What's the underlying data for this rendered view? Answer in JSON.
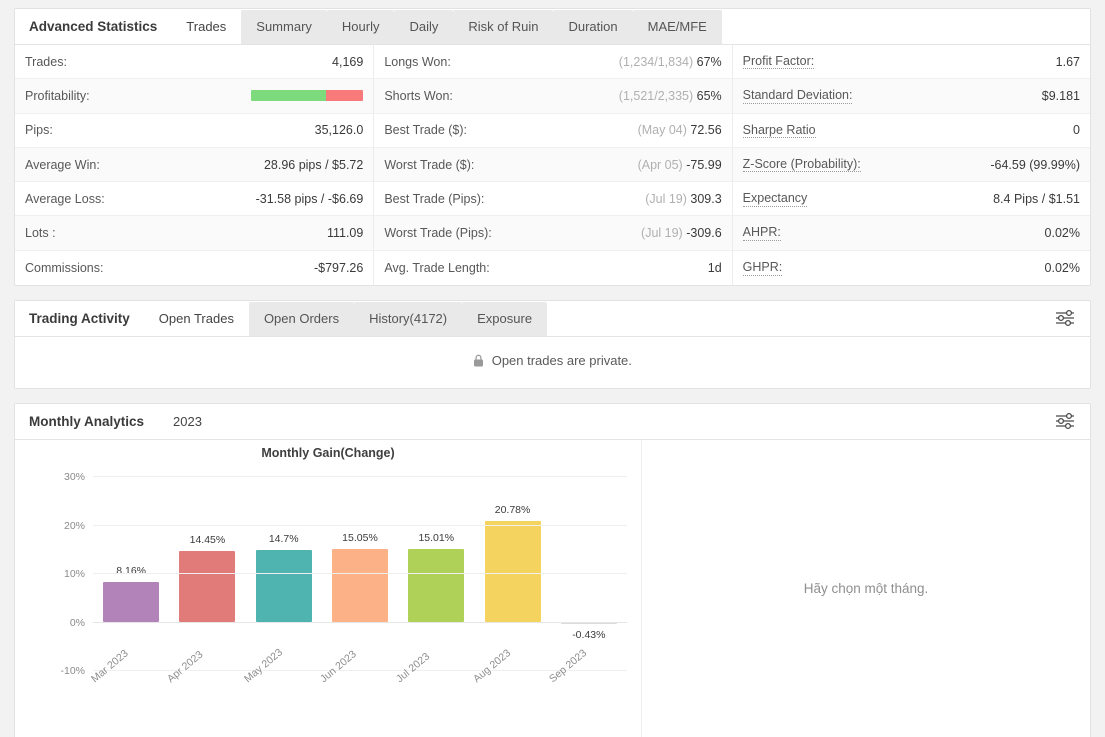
{
  "advanced_statistics": {
    "title": "Advanced Statistics",
    "tabs": [
      {
        "label": "Trades",
        "active": true
      },
      {
        "label": "Summary",
        "active": false
      },
      {
        "label": "Hourly",
        "active": false
      },
      {
        "label": "Daily",
        "active": false
      },
      {
        "label": "Risk of Ruin",
        "active": false
      },
      {
        "label": "Duration",
        "active": false
      },
      {
        "label": "MAE/MFE",
        "active": false
      }
    ],
    "columns": [
      {
        "rows": [
          {
            "label": "Trades:",
            "value": "4,169",
            "tip": false
          },
          {
            "label": "Profitability:",
            "value": "",
            "tip": false,
            "bar": {
              "win_pct": 67,
              "loss_pct": 33,
              "win_color": "#7ddb7d",
              "loss_color": "#f97a7a"
            }
          },
          {
            "label": "Pips:",
            "value": "35,126.0",
            "tip": false
          },
          {
            "label": "Average Win:",
            "value": "28.96 pips / $5.72",
            "tip": false
          },
          {
            "label": "Average Loss:",
            "value": "-31.58 pips / -$6.69",
            "tip": false
          },
          {
            "label": "Lots :",
            "value": "111.09",
            "tip": false
          },
          {
            "label": "Commissions:",
            "value": "-$797.26",
            "tip": false
          }
        ]
      },
      {
        "rows": [
          {
            "label": "Longs Won:",
            "muted": "(1,234/1,834)",
            "value": "67%",
            "tip": false
          },
          {
            "label": "Shorts Won:",
            "muted": "(1,521/2,335)",
            "value": "65%",
            "tip": false
          },
          {
            "label": "Best Trade ($):",
            "muted": "(May 04)",
            "value": "72.56",
            "tip": false
          },
          {
            "label": "Worst Trade ($):",
            "muted": "(Apr 05)",
            "value": "-75.99",
            "tip": false
          },
          {
            "label": "Best Trade (Pips):",
            "muted": "(Jul 19)",
            "value": "309.3",
            "tip": false
          },
          {
            "label": "Worst Trade (Pips):",
            "muted": "(Jul 19)",
            "value": "-309.6",
            "tip": false
          },
          {
            "label": "Avg. Trade Length:",
            "muted": "",
            "value": "1d",
            "tip": false
          }
        ]
      },
      {
        "rows": [
          {
            "label": "Profit Factor:",
            "value": "1.67",
            "tip": true
          },
          {
            "label": "Standard Deviation:",
            "value": "$9.181",
            "tip": true
          },
          {
            "label": "Sharpe Ratio",
            "value": "0",
            "tip": true
          },
          {
            "label": "Z-Score (Probability):",
            "value": "-64.59 (99.99%)",
            "tip": true
          },
          {
            "label": "Expectancy",
            "value": "8.4 Pips / $1.51",
            "tip": true
          },
          {
            "label": "AHPR:",
            "value": "0.02%",
            "tip": true
          },
          {
            "label": "GHPR:",
            "value": "0.02%",
            "tip": true
          }
        ]
      }
    ]
  },
  "trading_activity": {
    "title": "Trading Activity",
    "tabs": [
      {
        "label": "Open Trades",
        "active": true
      },
      {
        "label": "Open Orders",
        "active": false
      },
      {
        "label": "History(4172)",
        "active": false
      },
      {
        "label": "Exposure",
        "active": false
      }
    ],
    "settings_icon": "sliders-icon",
    "message": "Open trades are private.",
    "message_icon": "lock-icon"
  },
  "monthly_analytics": {
    "title": "Monthly Analytics",
    "tabs": [
      {
        "label": "2023",
        "active": true
      }
    ],
    "settings_icon": "sliders-icon",
    "right_pane_message": "Hãy chọn một tháng."
  },
  "chart_data": {
    "type": "bar",
    "title": "Monthly Gain(Change)",
    "xlabel": "",
    "ylabel": "",
    "categories": [
      "Mar 2023",
      "Apr 2023",
      "May 2023",
      "Jun 2023",
      "Jul 2023",
      "Aug 2023",
      "Sep 2023"
    ],
    "values": [
      8.16,
      14.45,
      14.7,
      15.05,
      15.01,
      20.78,
      -0.43
    ],
    "data_labels": [
      "8.16%",
      "14.45%",
      "14.7%",
      "15.05%",
      "15.01%",
      "20.78%",
      "-0.43%"
    ],
    "colors": [
      "#b183b8",
      "#e07b79",
      "#4fb3b0",
      "#fcb186",
      "#b0d158",
      "#f4d35e",
      "#dcdcdc"
    ],
    "ylim": [
      -10,
      30
    ],
    "yticks": [
      30,
      20,
      10,
      0,
      -10
    ],
    "ytick_labels": [
      "30%",
      "20%",
      "10%",
      "0%",
      "-10%"
    ],
    "grid": true,
    "legend": false
  }
}
